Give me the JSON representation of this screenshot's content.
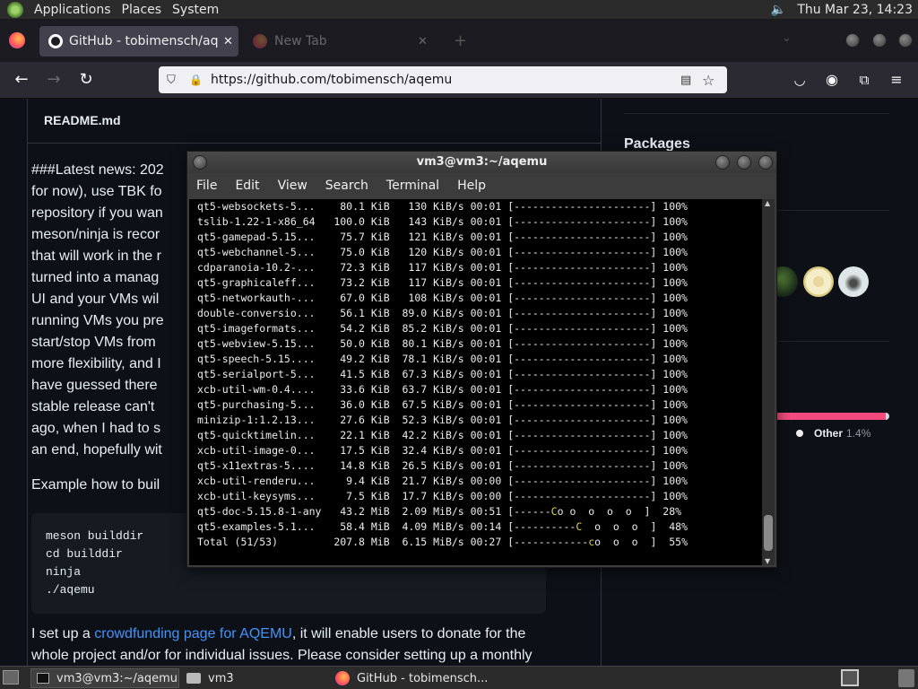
{
  "top_panel": {
    "menus": [
      "Applications",
      "Places",
      "System"
    ],
    "clock": "Thu Mar 23, 14:23"
  },
  "browser": {
    "tabs": [
      {
        "title": "GitHub - tobimensch/aqemu",
        "active": true
      },
      {
        "title": "New Tab",
        "active": false
      }
    ],
    "url": "https://github.com/tobimensch/aqemu"
  },
  "readme": {
    "filename": "README.md",
    "paragraph_lines": [
      "###Latest news: 202",
      "for now), use TBK fo",
      "repository if you wan",
      "meson/ninja is recor",
      "that will work in the r",
      "turned into a manag",
      "UI and your VMs wil",
      "running VMs you pre",
      "start/stop VMs from",
      "more flexibility, and I",
      "have guessed there",
      "stable release can't",
      "ago, when I had to s",
      "an end, hopefully wit"
    ],
    "build_intro": "Example how to buil",
    "code_lines": [
      "meson builddir",
      "cd builddir",
      "ninja",
      "./aqemu"
    ],
    "crowd_before": "I set up a ",
    "crowd_link": "crowdfunding page for AQEMU",
    "crowd_after": ", it will enable users to donate for the",
    "crowd_line2": "whole project and/or for individual issues. Please consider setting up a monthly"
  },
  "sidebar": {
    "packages_heading": "Packages",
    "language_other_label": "Other",
    "language_other_pct": "1.4%",
    "language_other_fraction": 0.986
  },
  "terminal": {
    "title": "vm3@vm3:~/aqemu",
    "menu": [
      "File",
      "Edit",
      "View",
      "Search",
      "Terminal",
      "Help"
    ],
    "lines": [
      {
        "name": "qt5-websockets-5...",
        "size": "80.1 KiB",
        "speed": "130 KiB/s",
        "time": "00:01",
        "bar": "[----------------------]",
        "pct": "100%"
      },
      {
        "name": "tslib-1.22-1-x86_64",
        "size": "100.0 KiB",
        "speed": "143 KiB/s",
        "time": "00:01",
        "bar": "[----------------------]",
        "pct": "100%"
      },
      {
        "name": "qt5-gamepad-5.15...",
        "size": "75.7 KiB",
        "speed": "121 KiB/s",
        "time": "00:01",
        "bar": "[----------------------]",
        "pct": "100%"
      },
      {
        "name": "qt5-webchannel-5...",
        "size": "75.0 KiB",
        "speed": "120 KiB/s",
        "time": "00:01",
        "bar": "[----------------------]",
        "pct": "100%"
      },
      {
        "name": "cdparanoia-10.2-...",
        "size": "72.3 KiB",
        "speed": "117 KiB/s",
        "time": "00:01",
        "bar": "[----------------------]",
        "pct": "100%"
      },
      {
        "name": "qt5-graphicaleff...",
        "size": "73.2 KiB",
        "speed": "117 KiB/s",
        "time": "00:01",
        "bar": "[----------------------]",
        "pct": "100%"
      },
      {
        "name": "qt5-networkauth-...",
        "size": "67.0 KiB",
        "speed": "108 KiB/s",
        "time": "00:01",
        "bar": "[----------------------]",
        "pct": "100%"
      },
      {
        "name": "double-conversio...",
        "size": "56.1 KiB",
        "speed": "89.0 KiB/s",
        "time": "00:01",
        "bar": "[----------------------]",
        "pct": "100%"
      },
      {
        "name": "qt5-imageformats...",
        "size": "54.2 KiB",
        "speed": "85.2 KiB/s",
        "time": "00:01",
        "bar": "[----------------------]",
        "pct": "100%"
      },
      {
        "name": "qt5-webview-5.15...",
        "size": "50.0 KiB",
        "speed": "80.1 KiB/s",
        "time": "00:01",
        "bar": "[----------------------]",
        "pct": "100%"
      },
      {
        "name": "qt5-speech-5.15....",
        "size": "49.2 KiB",
        "speed": "78.1 KiB/s",
        "time": "00:01",
        "bar": "[----------------------]",
        "pct": "100%"
      },
      {
        "name": "qt5-serialport-5...",
        "size": "41.5 KiB",
        "speed": "67.3 KiB/s",
        "time": "00:01",
        "bar": "[----------------------]",
        "pct": "100%"
      },
      {
        "name": "xcb-util-wm-0.4....",
        "size": "33.6 KiB",
        "speed": "63.7 KiB/s",
        "time": "00:01",
        "bar": "[----------------------]",
        "pct": "100%"
      },
      {
        "name": "qt5-purchasing-5...",
        "size": "36.0 KiB",
        "speed": "67.5 KiB/s",
        "time": "00:01",
        "bar": "[----------------------]",
        "pct": "100%"
      },
      {
        "name": "minizip-1:1.2.13...",
        "size": "27.6 KiB",
        "speed": "52.3 KiB/s",
        "time": "00:01",
        "bar": "[----------------------]",
        "pct": "100%"
      },
      {
        "name": "qt5-quicktimelin...",
        "size": "22.1 KiB",
        "speed": "42.2 KiB/s",
        "time": "00:01",
        "bar": "[----------------------]",
        "pct": "100%"
      },
      {
        "name": "xcb-util-image-0...",
        "size": "17.5 KiB",
        "speed": "32.4 KiB/s",
        "time": "00:01",
        "bar": "[----------------------]",
        "pct": "100%"
      },
      {
        "name": "qt5-x11extras-5....",
        "size": "14.8 KiB",
        "speed": "26.5 KiB/s",
        "time": "00:01",
        "bar": "[----------------------]",
        "pct": "100%"
      },
      {
        "name": "xcb-util-renderu...",
        "size": "9.4 KiB",
        "speed": "21.7 KiB/s",
        "time": "00:00",
        "bar": "[----------------------]",
        "pct": "100%"
      },
      {
        "name": "xcb-util-keysyms...",
        "size": "7.5 KiB",
        "speed": "17.7 KiB/s",
        "time": "00:00",
        "bar": "[----------------------]",
        "pct": "100%"
      },
      {
        "name": "qt5-doc-5.15.8-1-any",
        "size": "43.2 MiB",
        "speed": "2.09 MiB/s",
        "time": "00:51",
        "bar": "[------Co o  o  o  o  ]",
        "pct": "28%"
      },
      {
        "name": "qt5-examples-5.1...",
        "size": "58.4 MiB",
        "speed": "4.09 MiB/s",
        "time": "00:14",
        "bar": "[----------C  o  o  o  ]",
        "pct": "48%"
      },
      {
        "name": "Total (51/53)",
        "size": "207.8 MiB",
        "speed": "6.15 MiB/s",
        "time": "00:27",
        "bar": "[------------co  o  o  ]",
        "pct": "55%"
      }
    ]
  },
  "taskbar": {
    "items": [
      "vm3@vm3:~/aqemu",
      "vm3",
      "GitHub - tobimensch..."
    ]
  }
}
